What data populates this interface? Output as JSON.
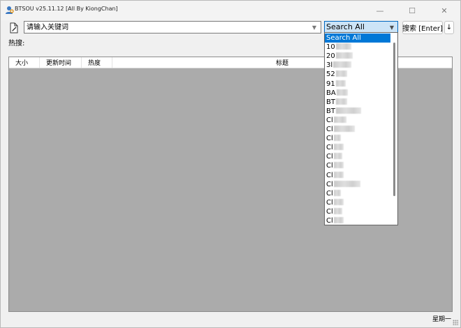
{
  "window": {
    "title": "BTSOU v25.11.12 [All By KiongChan]",
    "controls": {
      "minimize": "—",
      "maximize": "☐",
      "close": "✕"
    }
  },
  "toolbar": {
    "file_icon": "document-edit-icon",
    "search_placeholder": "请输入关键词",
    "source_selected": "Search All",
    "search_button": "搜索 [Enter]",
    "sort_button": "↓"
  },
  "hot_label": "热搜:",
  "table": {
    "columns": [
      "大小",
      "更新时间",
      "热度",
      "标题"
    ]
  },
  "dropdown": {
    "items": [
      {
        "prefix": "Search All",
        "selected": true
      },
      {
        "prefix": "10"
      },
      {
        "prefix": "20"
      },
      {
        "prefix": "3l"
      },
      {
        "prefix": "52"
      },
      {
        "prefix": "91"
      },
      {
        "prefix": "BA"
      },
      {
        "prefix": "BT"
      },
      {
        "prefix": "BT"
      },
      {
        "prefix": "Cl"
      },
      {
        "prefix": "Cl"
      },
      {
        "prefix": "Cl"
      },
      {
        "prefix": "Cl"
      },
      {
        "prefix": "Cl"
      },
      {
        "prefix": "Cl"
      },
      {
        "prefix": "Cl"
      },
      {
        "prefix": "Cl"
      },
      {
        "prefix": "Cl"
      },
      {
        "prefix": "Cl"
      },
      {
        "prefix": "Cl"
      },
      {
        "prefix": "Cl"
      },
      {
        "prefix": "EC"
      }
    ]
  },
  "status_bar": {
    "weekday": "星期一"
  }
}
